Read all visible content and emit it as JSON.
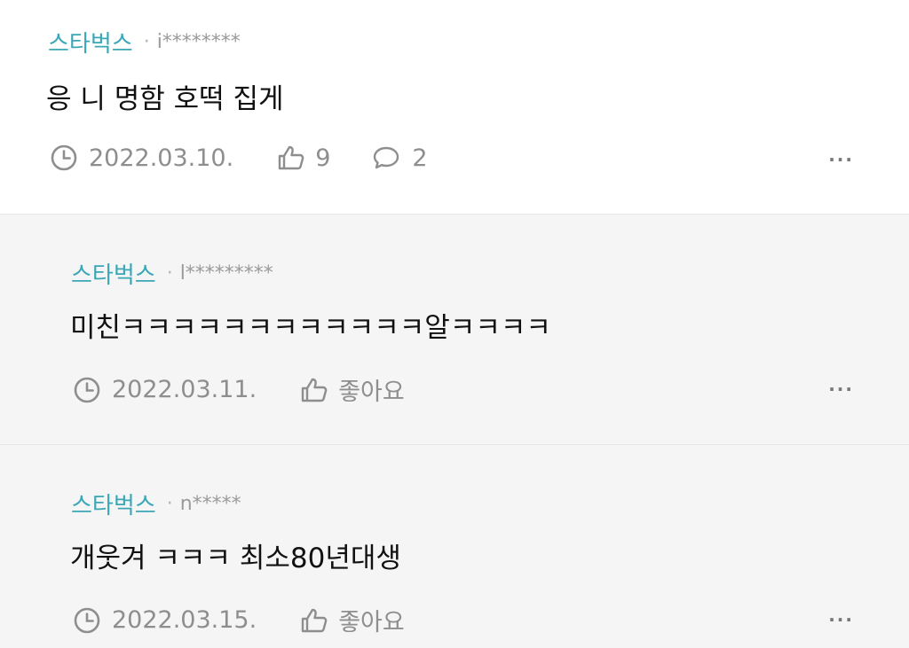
{
  "comments": [
    {
      "source": "스타벅스",
      "separator": "·",
      "user": "i********",
      "text": "응 니 명함 호떡 집게",
      "date": "2022.03.10.",
      "likes": "9",
      "replies": "2",
      "more": "···"
    },
    {
      "source": "스타벅스",
      "separator": "·",
      "user": "l*********",
      "text": "미친ㅋㅋㅋㅋㅋㅋㅋㅋㅋㅋㅋㅋ알ㅋㅋㅋㅋ",
      "date": "2022.03.11.",
      "like_label": "좋아요",
      "more": "···"
    },
    {
      "source": "스타벅스",
      "separator": "·",
      "user": "n*****",
      "text": "개웃겨 ㅋㅋㅋ 최소80년대생",
      "date": "2022.03.15.",
      "like_label": "좋아요",
      "more": "···"
    }
  ],
  "icons": {
    "clock": "clock-icon",
    "like": "thumbs-up-icon",
    "reply": "speech-bubble-icon",
    "more": "more-icon"
  },
  "colors": {
    "brand": "#3ba7b6",
    "meta": "#8e8e8e",
    "reply_background": "#f5f5f5"
  }
}
